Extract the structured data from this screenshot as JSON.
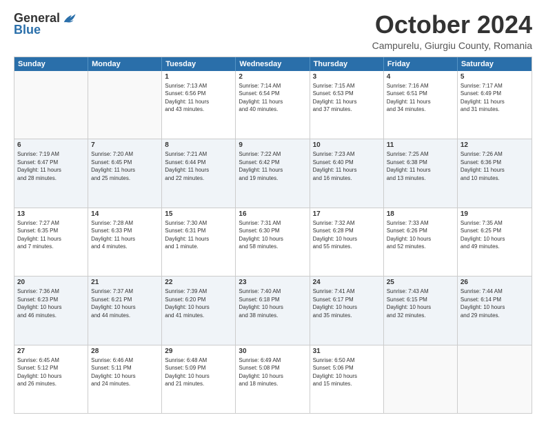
{
  "logo": {
    "general": "General",
    "blue": "Blue"
  },
  "title": "October 2024",
  "subtitle": "Campurelu, Giurgiu County, Romania",
  "headers": [
    "Sunday",
    "Monday",
    "Tuesday",
    "Wednesday",
    "Thursday",
    "Friday",
    "Saturday"
  ],
  "rows": [
    [
      {
        "day": "",
        "lines": []
      },
      {
        "day": "",
        "lines": []
      },
      {
        "day": "1",
        "lines": [
          "Sunrise: 7:13 AM",
          "Sunset: 6:56 PM",
          "Daylight: 11 hours",
          "and 43 minutes."
        ]
      },
      {
        "day": "2",
        "lines": [
          "Sunrise: 7:14 AM",
          "Sunset: 6:54 PM",
          "Daylight: 11 hours",
          "and 40 minutes."
        ]
      },
      {
        "day": "3",
        "lines": [
          "Sunrise: 7:15 AM",
          "Sunset: 6:53 PM",
          "Daylight: 11 hours",
          "and 37 minutes."
        ]
      },
      {
        "day": "4",
        "lines": [
          "Sunrise: 7:16 AM",
          "Sunset: 6:51 PM",
          "Daylight: 11 hours",
          "and 34 minutes."
        ]
      },
      {
        "day": "5",
        "lines": [
          "Sunrise: 7:17 AM",
          "Sunset: 6:49 PM",
          "Daylight: 11 hours",
          "and 31 minutes."
        ]
      }
    ],
    [
      {
        "day": "6",
        "lines": [
          "Sunrise: 7:19 AM",
          "Sunset: 6:47 PM",
          "Daylight: 11 hours",
          "and 28 minutes."
        ]
      },
      {
        "day": "7",
        "lines": [
          "Sunrise: 7:20 AM",
          "Sunset: 6:45 PM",
          "Daylight: 11 hours",
          "and 25 minutes."
        ]
      },
      {
        "day": "8",
        "lines": [
          "Sunrise: 7:21 AM",
          "Sunset: 6:44 PM",
          "Daylight: 11 hours",
          "and 22 minutes."
        ]
      },
      {
        "day": "9",
        "lines": [
          "Sunrise: 7:22 AM",
          "Sunset: 6:42 PM",
          "Daylight: 11 hours",
          "and 19 minutes."
        ]
      },
      {
        "day": "10",
        "lines": [
          "Sunrise: 7:23 AM",
          "Sunset: 6:40 PM",
          "Daylight: 11 hours",
          "and 16 minutes."
        ]
      },
      {
        "day": "11",
        "lines": [
          "Sunrise: 7:25 AM",
          "Sunset: 6:38 PM",
          "Daylight: 11 hours",
          "and 13 minutes."
        ]
      },
      {
        "day": "12",
        "lines": [
          "Sunrise: 7:26 AM",
          "Sunset: 6:36 PM",
          "Daylight: 11 hours",
          "and 10 minutes."
        ]
      }
    ],
    [
      {
        "day": "13",
        "lines": [
          "Sunrise: 7:27 AM",
          "Sunset: 6:35 PM",
          "Daylight: 11 hours",
          "and 7 minutes."
        ]
      },
      {
        "day": "14",
        "lines": [
          "Sunrise: 7:28 AM",
          "Sunset: 6:33 PM",
          "Daylight: 11 hours",
          "and 4 minutes."
        ]
      },
      {
        "day": "15",
        "lines": [
          "Sunrise: 7:30 AM",
          "Sunset: 6:31 PM",
          "Daylight: 11 hours",
          "and 1 minute."
        ]
      },
      {
        "day": "16",
        "lines": [
          "Sunrise: 7:31 AM",
          "Sunset: 6:30 PM",
          "Daylight: 10 hours",
          "and 58 minutes."
        ]
      },
      {
        "day": "17",
        "lines": [
          "Sunrise: 7:32 AM",
          "Sunset: 6:28 PM",
          "Daylight: 10 hours",
          "and 55 minutes."
        ]
      },
      {
        "day": "18",
        "lines": [
          "Sunrise: 7:33 AM",
          "Sunset: 6:26 PM",
          "Daylight: 10 hours",
          "and 52 minutes."
        ]
      },
      {
        "day": "19",
        "lines": [
          "Sunrise: 7:35 AM",
          "Sunset: 6:25 PM",
          "Daylight: 10 hours",
          "and 49 minutes."
        ]
      }
    ],
    [
      {
        "day": "20",
        "lines": [
          "Sunrise: 7:36 AM",
          "Sunset: 6:23 PM",
          "Daylight: 10 hours",
          "and 46 minutes."
        ]
      },
      {
        "day": "21",
        "lines": [
          "Sunrise: 7:37 AM",
          "Sunset: 6:21 PM",
          "Daylight: 10 hours",
          "and 44 minutes."
        ]
      },
      {
        "day": "22",
        "lines": [
          "Sunrise: 7:39 AM",
          "Sunset: 6:20 PM",
          "Daylight: 10 hours",
          "and 41 minutes."
        ]
      },
      {
        "day": "23",
        "lines": [
          "Sunrise: 7:40 AM",
          "Sunset: 6:18 PM",
          "Daylight: 10 hours",
          "and 38 minutes."
        ]
      },
      {
        "day": "24",
        "lines": [
          "Sunrise: 7:41 AM",
          "Sunset: 6:17 PM",
          "Daylight: 10 hours",
          "and 35 minutes."
        ]
      },
      {
        "day": "25",
        "lines": [
          "Sunrise: 7:43 AM",
          "Sunset: 6:15 PM",
          "Daylight: 10 hours",
          "and 32 minutes."
        ]
      },
      {
        "day": "26",
        "lines": [
          "Sunrise: 7:44 AM",
          "Sunset: 6:14 PM",
          "Daylight: 10 hours",
          "and 29 minutes."
        ]
      }
    ],
    [
      {
        "day": "27",
        "lines": [
          "Sunrise: 6:45 AM",
          "Sunset: 5:12 PM",
          "Daylight: 10 hours",
          "and 26 minutes."
        ]
      },
      {
        "day": "28",
        "lines": [
          "Sunrise: 6:46 AM",
          "Sunset: 5:11 PM",
          "Daylight: 10 hours",
          "and 24 minutes."
        ]
      },
      {
        "day": "29",
        "lines": [
          "Sunrise: 6:48 AM",
          "Sunset: 5:09 PM",
          "Daylight: 10 hours",
          "and 21 minutes."
        ]
      },
      {
        "day": "30",
        "lines": [
          "Sunrise: 6:49 AM",
          "Sunset: 5:08 PM",
          "Daylight: 10 hours",
          "and 18 minutes."
        ]
      },
      {
        "day": "31",
        "lines": [
          "Sunrise: 6:50 AM",
          "Sunset: 5:06 PM",
          "Daylight: 10 hours",
          "and 15 minutes."
        ]
      },
      {
        "day": "",
        "lines": []
      },
      {
        "day": "",
        "lines": []
      }
    ]
  ]
}
